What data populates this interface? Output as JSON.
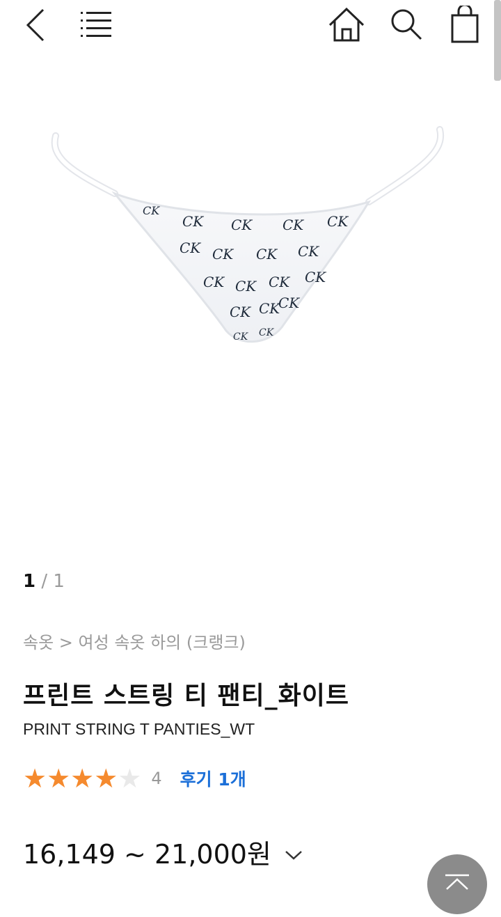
{
  "header": {
    "back_icon": "chevron-left-icon",
    "menu_icon": "menu-icon",
    "home_icon": "home-icon",
    "search_icon": "search-icon",
    "cart_icon": "shopping-bag-icon"
  },
  "gallery": {
    "current": "1",
    "separator": "/",
    "total": "1",
    "image_print_text": "CK"
  },
  "product": {
    "breadcrumb": "속옷 > 여성 속옷 하의 (크랭크)",
    "title": "프린트 스트링 티 팬티_화이트",
    "subtitle": "PRINT STRING T PANTIES_WT",
    "rating_stars": 4,
    "rating_max": 5,
    "rating_value": "4",
    "review_link": "후기 1개",
    "price": "16,149 ~ 21,000원"
  },
  "colors": {
    "star_on": "#f58a2e",
    "star_off": "#e9e9e9",
    "review_link": "#1b6fd8",
    "text_muted": "#9a9a9a"
  },
  "scroll_top_icon": "arrow-up-icon"
}
